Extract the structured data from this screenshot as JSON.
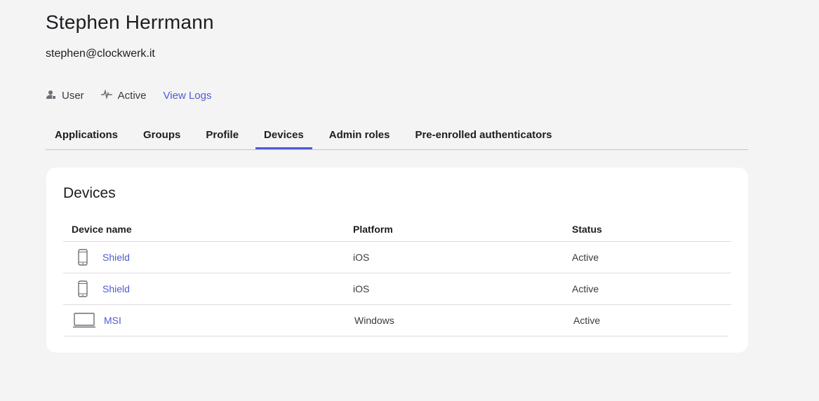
{
  "user": {
    "name": "Stephen Herrmann",
    "email": "stephen@clockwerk.it",
    "role_label": "User",
    "status_label": "Active",
    "view_logs_label": "View Logs"
  },
  "tabs": [
    {
      "label": "Applications",
      "active": false
    },
    {
      "label": "Groups",
      "active": false
    },
    {
      "label": "Profile",
      "active": false
    },
    {
      "label": "Devices",
      "active": true
    },
    {
      "label": "Admin roles",
      "active": false
    },
    {
      "label": "Pre-enrolled authenticators",
      "active": false
    }
  ],
  "devices": {
    "title": "Devices",
    "columns": {
      "name": "Device name",
      "platform": "Platform",
      "status": "Status"
    },
    "rows": [
      {
        "name": "Shield",
        "platform": "iOS",
        "status": "Active",
        "icon": "phone-icon"
      },
      {
        "name": "Shield",
        "platform": "iOS",
        "status": "Active",
        "icon": "phone-icon"
      },
      {
        "name": "MSI",
        "platform": "Windows",
        "status": "Active",
        "icon": "laptop-icon"
      }
    ]
  },
  "colors": {
    "accent": "#4f5bd5",
    "background": "#f4f4f4",
    "card": "#ffffff",
    "text": "#1d1d21"
  }
}
